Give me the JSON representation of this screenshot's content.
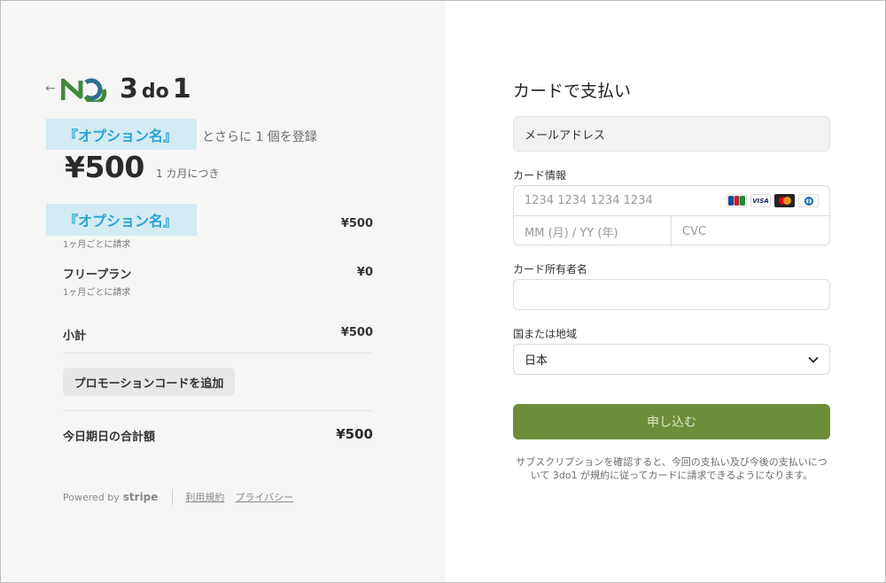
{
  "header": {
    "back_icon": "arrow-left-icon",
    "logo_text_3": "3",
    "logo_text_do": "do",
    "logo_text_1": "1",
    "brand_color": "#3f8a3a"
  },
  "summary": {
    "option_name": "『オプション名』",
    "subtitle_rest": "とさらに 1 個を登録",
    "price": "¥500",
    "period": "1 カ月につき"
  },
  "items": [
    {
      "name": "『オプション名』",
      "price": "¥500",
      "billing": "1ヶ月ごとに請求"
    },
    {
      "name": "フリープラン",
      "price": "¥0",
      "billing": "1ヶ月ごとに請求"
    }
  ],
  "subtotal": {
    "label": "小計",
    "price": "¥500"
  },
  "promo_button": "プロモーションコードを追加",
  "total": {
    "label": "今日期日の合計額",
    "price": "¥500"
  },
  "footer": {
    "powered_by": "Powered by",
    "stripe": "stripe",
    "terms": "利用規約",
    "privacy": "プライバシー"
  },
  "form": {
    "title": "カードで支払い",
    "email_label": "メールアドレス",
    "card_label": "カード情報",
    "card_number_placeholder": "1234 1234 1234 1234",
    "card_brands": [
      "JCB",
      "VISA",
      "Mastercard",
      "Diners"
    ],
    "expiry_placeholder": "MM (月) / YY (年)",
    "cvc_placeholder": "CVC",
    "cardholder_label": "カード所有者名",
    "country_label": "国または地域",
    "country_value": "日本",
    "submit_label": "申し込む",
    "submit_color": "#6e8d39",
    "terms_text": "サブスクリプションを確認すると、今回の支払い及び今後の支払いについて 3do1 が規約に従ってカードに請求できるようになります。"
  }
}
